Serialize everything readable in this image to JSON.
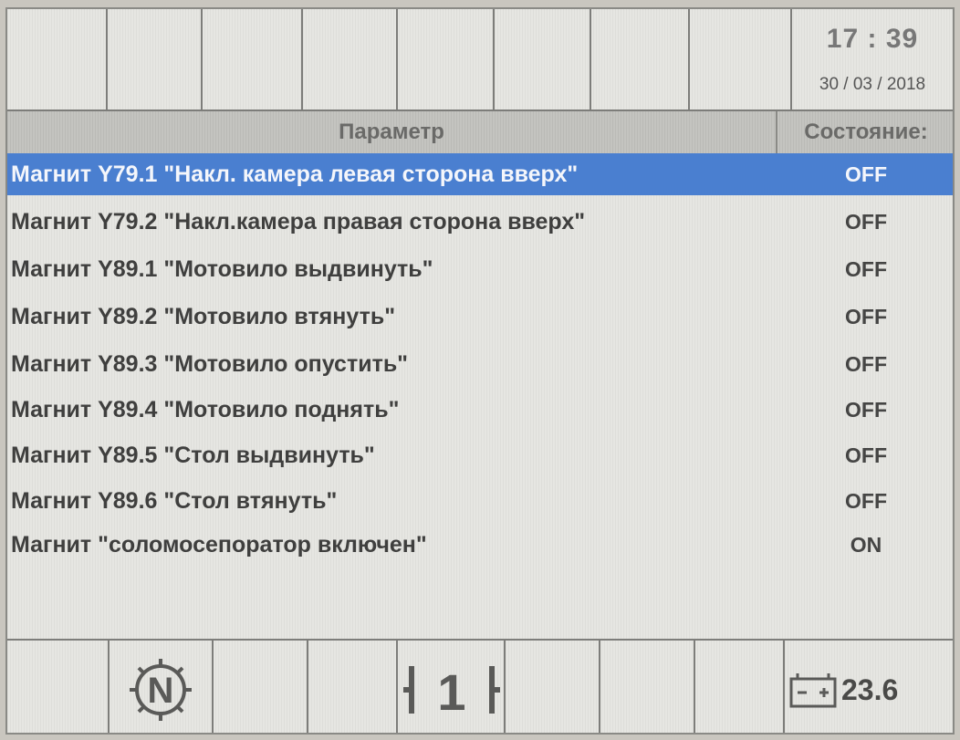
{
  "clock": {
    "time": "17 : 39",
    "date": "30 / 03 / 2018"
  },
  "table": {
    "headers": {
      "parameter": "Параметр",
      "state": "Состояние:"
    },
    "selected_index": 0,
    "rows": [
      {
        "name": "Магнит Y79.1 \"Накл. камера левая сторона вверх\"",
        "state": "OFF"
      },
      {
        "name": "Магнит Y79.2 \"Накл.камера правая сторона вверх\"",
        "state": "OFF"
      },
      {
        "name": "Магнит Y89.1 \"Мотовило выдвинуть\"",
        "state": "OFF"
      },
      {
        "name": "Магнит Y89.2 \"Мотовило втянуть\"",
        "state": "OFF"
      },
      {
        "name": "Магнит Y89.3 \"Мотовило опустить\"",
        "state": "OFF"
      },
      {
        "name": "Магнит Y89.4 \"Мотовило поднять\"",
        "state": "OFF"
      },
      {
        "name": "Магнит Y89.5 \"Стол выдвинуть\"",
        "state": "OFF"
      },
      {
        "name": "Магнит Y89.6 \"Стол втянуть\"",
        "state": "OFF"
      },
      {
        "name": "Магнит \"соломосепоратор включен\"",
        "state": "ON"
      }
    ]
  },
  "status_bar": {
    "neutral_icon": "neutral-gear-icon",
    "neutral_letter": "N",
    "gear_icon": "gear-indicator-icon",
    "gear_number": "1",
    "battery_icon": "battery-icon",
    "battery_voltage": "23.6"
  },
  "colors": {
    "selection": "#4a7fd0",
    "screen_bg": "#e6e6e2"
  }
}
